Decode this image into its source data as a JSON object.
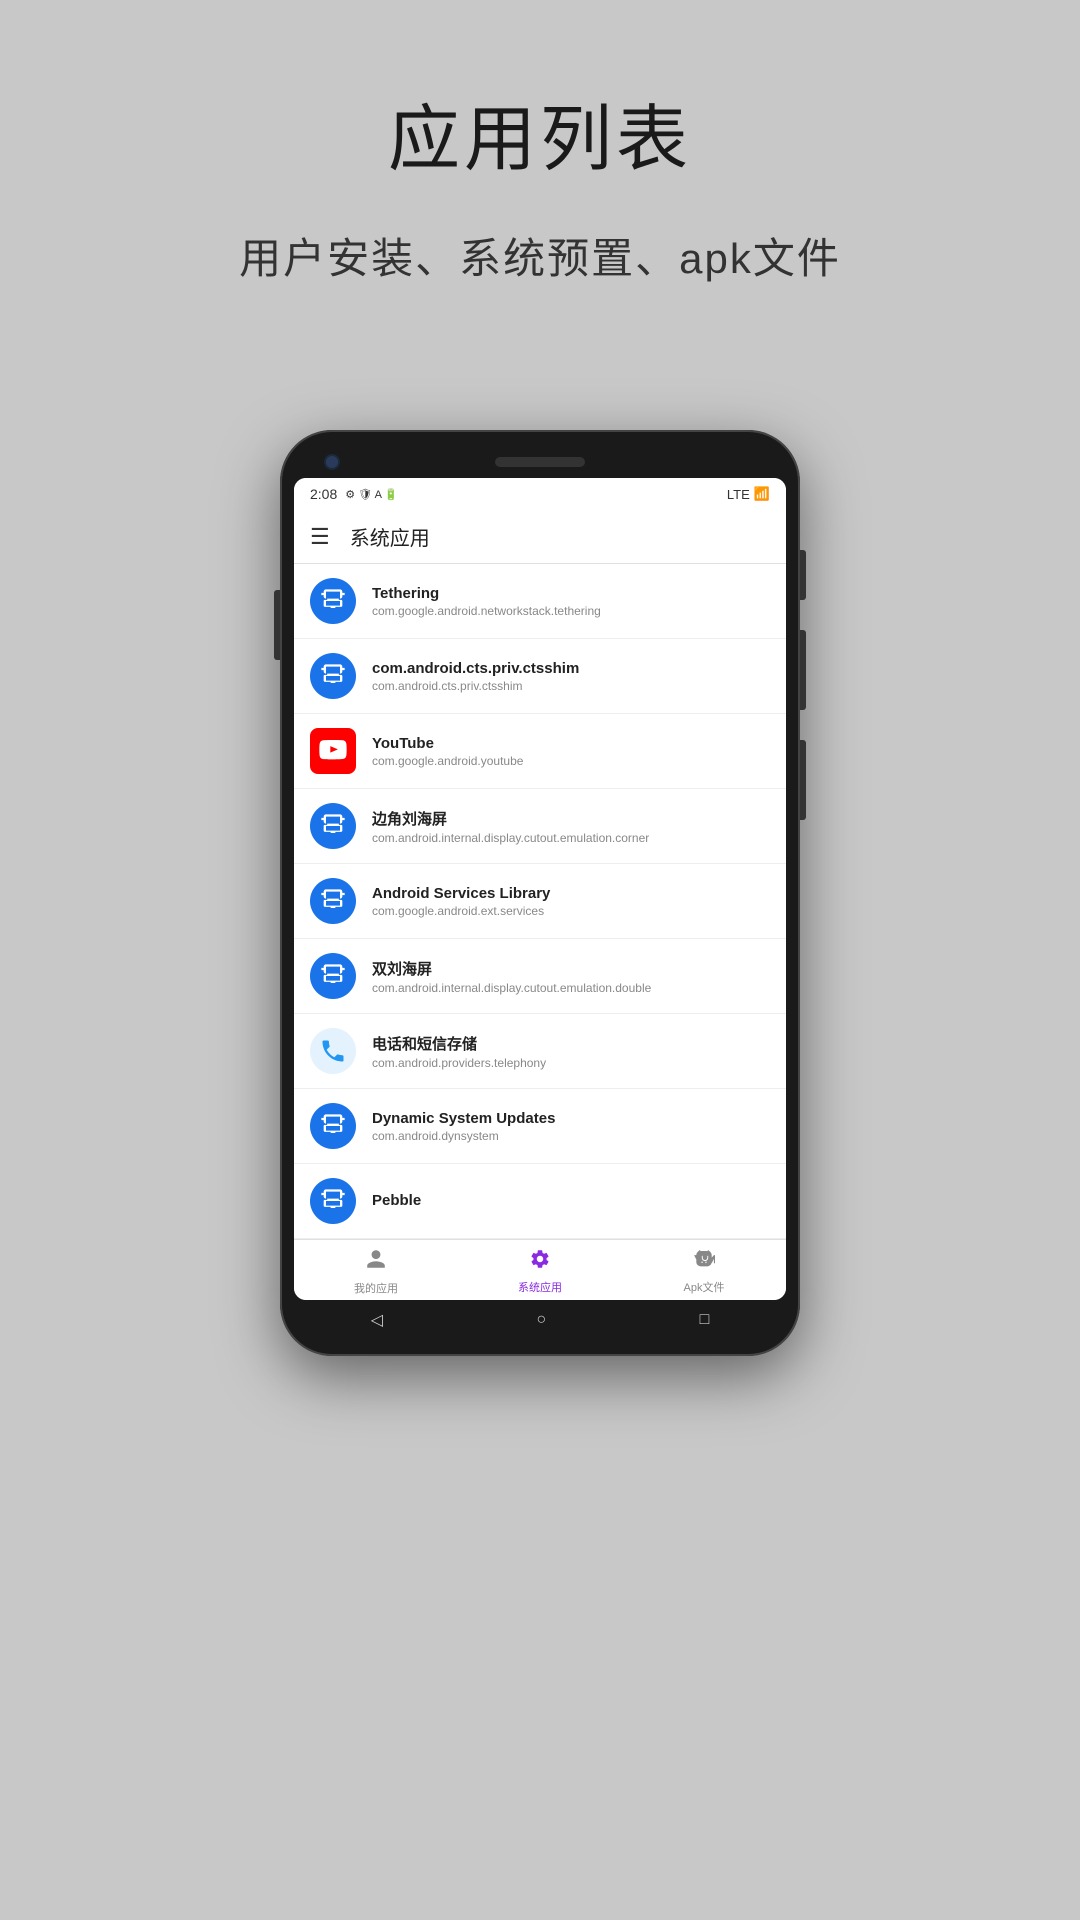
{
  "page": {
    "title": "应用列表",
    "subtitle": "用户安装、系统预置、apk文件"
  },
  "statusBar": {
    "time": "2:08",
    "network": "LTE",
    "icons": [
      "⚙",
      "🛡",
      "A",
      "🔋"
    ]
  },
  "appBar": {
    "title": "系统应用"
  },
  "apps": [
    {
      "name": "Tethering",
      "package": "com.google.android.networkstack.tethering",
      "iconType": "android-blue"
    },
    {
      "name": "com.android.cts.priv.ctsshim",
      "package": "com.android.cts.priv.ctsshim",
      "iconType": "android-blue"
    },
    {
      "name": "YouTube",
      "package": "com.google.android.youtube",
      "iconType": "youtube"
    },
    {
      "name": "边角刘海屏",
      "package": "com.android.internal.display.cutout.emulation.corner",
      "iconType": "android-blue"
    },
    {
      "name": "Android Services Library",
      "package": "com.google.android.ext.services",
      "iconType": "android-blue"
    },
    {
      "name": "双刘海屏",
      "package": "com.android.internal.display.cutout.emulation.double",
      "iconType": "android-blue"
    },
    {
      "name": "电话和短信存储",
      "package": "com.android.providers.telephony",
      "iconType": "phone-blue"
    },
    {
      "name": "Dynamic System Updates",
      "package": "com.android.dynsystem",
      "iconType": "android-blue"
    },
    {
      "name": "Pebble",
      "package": "",
      "iconType": "android-blue"
    }
  ],
  "bottomNav": [
    {
      "label": "我的应用",
      "active": false,
      "icon": "person"
    },
    {
      "label": "系统应用",
      "active": true,
      "icon": "gear"
    },
    {
      "label": "Apk文件",
      "active": false,
      "icon": "android"
    }
  ]
}
